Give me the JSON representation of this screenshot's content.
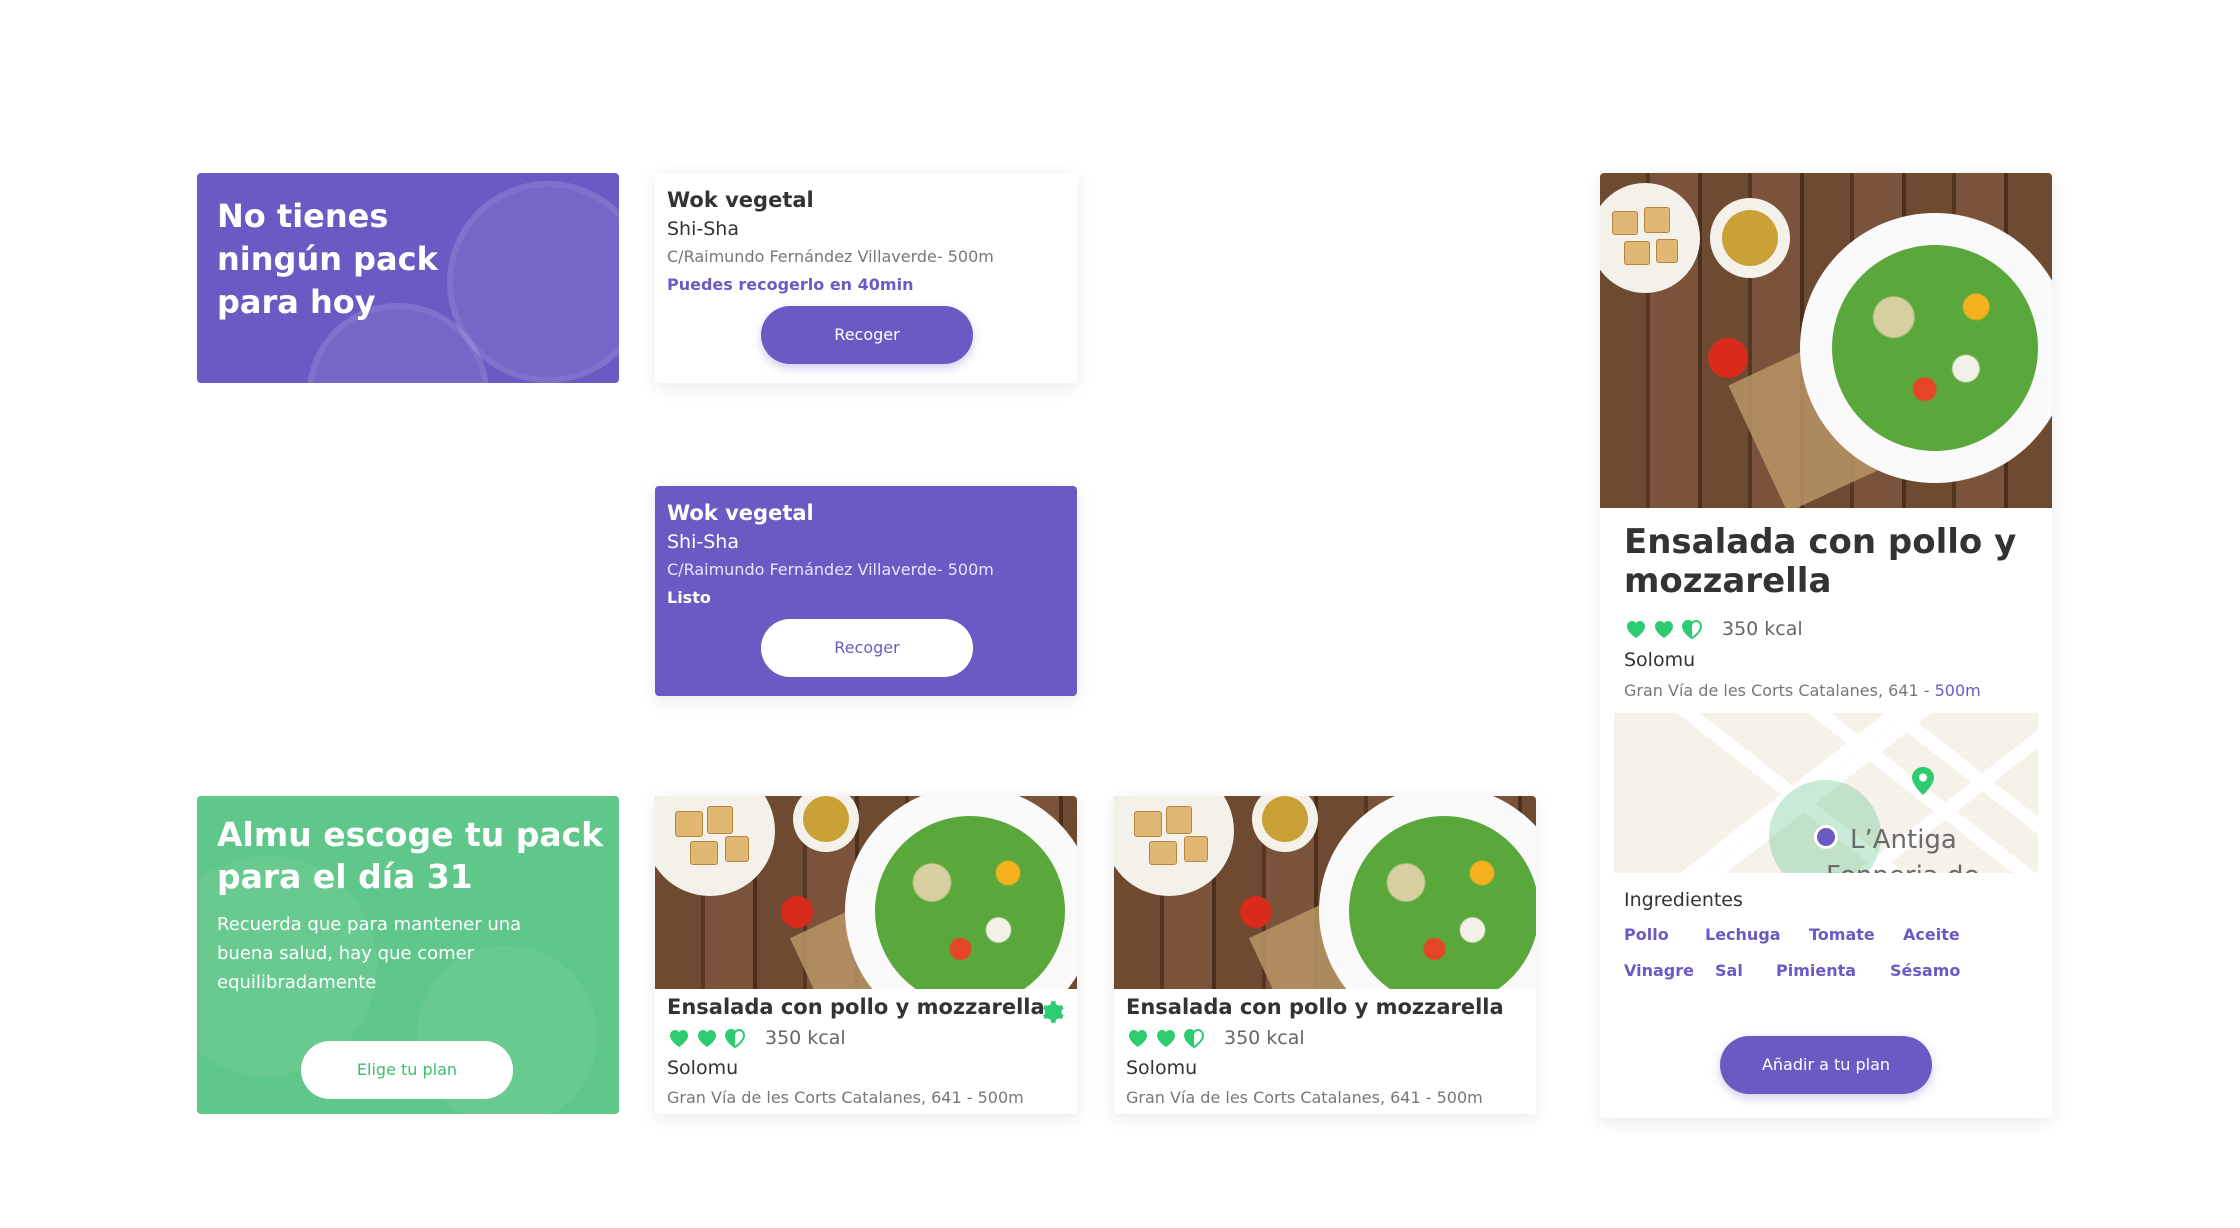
{
  "promo_no_pack": {
    "title": "No tienes ningún pack para hoy"
  },
  "order_card_pending": {
    "dish": "Wok vegetal",
    "restaurant": "Shi-Sha",
    "address": "C/Raimundo Fernández Villaverde- 500m",
    "status": "Puedes recogerlo en 40min",
    "button": "Recoger"
  },
  "order_card_ready": {
    "dish": "Wok vegetal",
    "restaurant": "Shi-Sha",
    "address": "C/Raimundo Fernández Villaverde- 500m",
    "status": "Listo",
    "button": "Recoger"
  },
  "promo_choose": {
    "title": "Almu escoge tu pack para el día 31",
    "text": "Recuerda que para mantener una buena salud, hay que comer equilibradamente",
    "button": "Elige tu plan"
  },
  "salad_cards": [
    {
      "title": "Ensalada con pollo y mozzarella",
      "rating_hearts": 2.5,
      "kcal": "350 kcal",
      "restaurant": "Solomu",
      "address": "Gran Vía de les Corts Catalanes, 641 - 500m",
      "icon": "gear-icon"
    },
    {
      "title": "Ensalada con pollo y mozzarella",
      "rating_hearts": 2.5,
      "kcal": "350 kcal",
      "restaurant": "Solomu",
      "address": "Gran Vía de les Corts Catalanes, 641 - 500m"
    }
  ],
  "detail": {
    "title": "Ensalada con pollo y mozzarella",
    "rating_hearts": 2.5,
    "kcal": "350 kcal",
    "restaurant": "Solomu",
    "address": "Gran Vía de les Corts Catalanes, 641 - ",
    "distance": "500m",
    "map_label_line1": "L’Antiga",
    "map_label_line2": "Fonneria de",
    "ingredients_title": "Ingredientes",
    "ingredients": [
      "Pollo",
      "Lechuga",
      "Tomate",
      "Aceite",
      "Vinagre",
      "Sal",
      "Pimienta",
      "Sésamo"
    ],
    "button": "Añadir a tu plan"
  },
  "colors": {
    "primary_purple": "#6a5bc4",
    "accent_green": "#5fc789",
    "heart_green": "#2ecc71"
  }
}
